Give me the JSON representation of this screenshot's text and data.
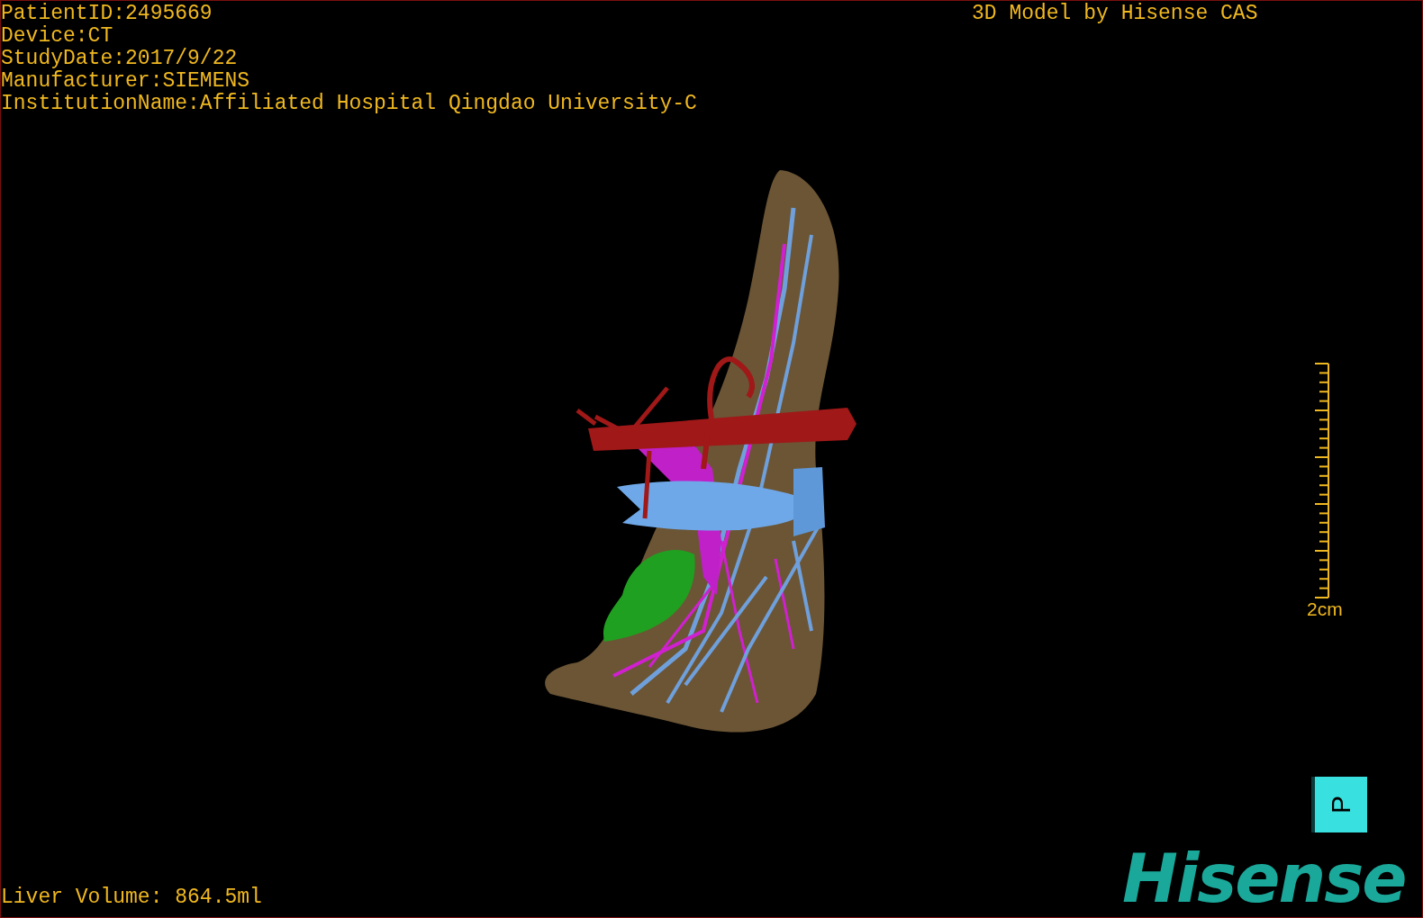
{
  "info_lines": [
    "PatientID:2495669",
    "Device:CT",
    "StudyDate:2017/9/22",
    "Manufacturer:SIEMENS",
    "InstitutionName:Affiliated Hospital Qingdao University-C"
  ],
  "title": "3D Model by Hisense CAS",
  "scale_bar": {
    "label": "2cm"
  },
  "orientation_cube": {
    "label": "P"
  },
  "logo": "Hisense",
  "liver_volume": "Liver Volume: 864.5ml"
}
